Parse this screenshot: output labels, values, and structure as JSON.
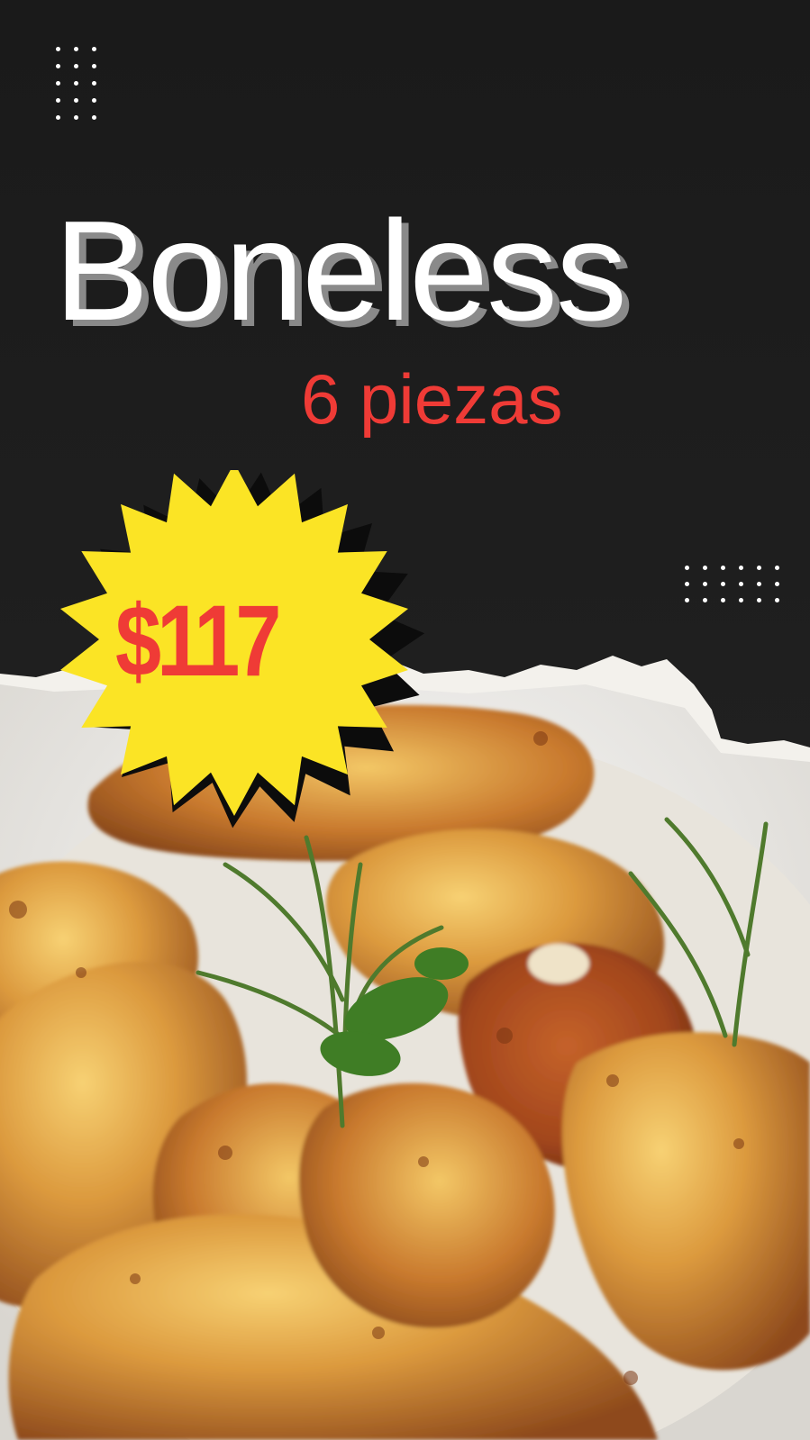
{
  "poster": {
    "title": "Boneless",
    "subtitle": "6 piezas",
    "price": "$117"
  },
  "colors": {
    "background": "#1c1c1c",
    "title": "#ffffff",
    "title_shadow": "#8a8a8a",
    "accent_red": "#ef3b36",
    "badge_yellow": "#fbe425"
  },
  "icons": {
    "top_dots": "dot-grid-3x5-icon",
    "right_dots": "dot-grid-6x3-icon",
    "price_badge": "starburst-badge"
  }
}
